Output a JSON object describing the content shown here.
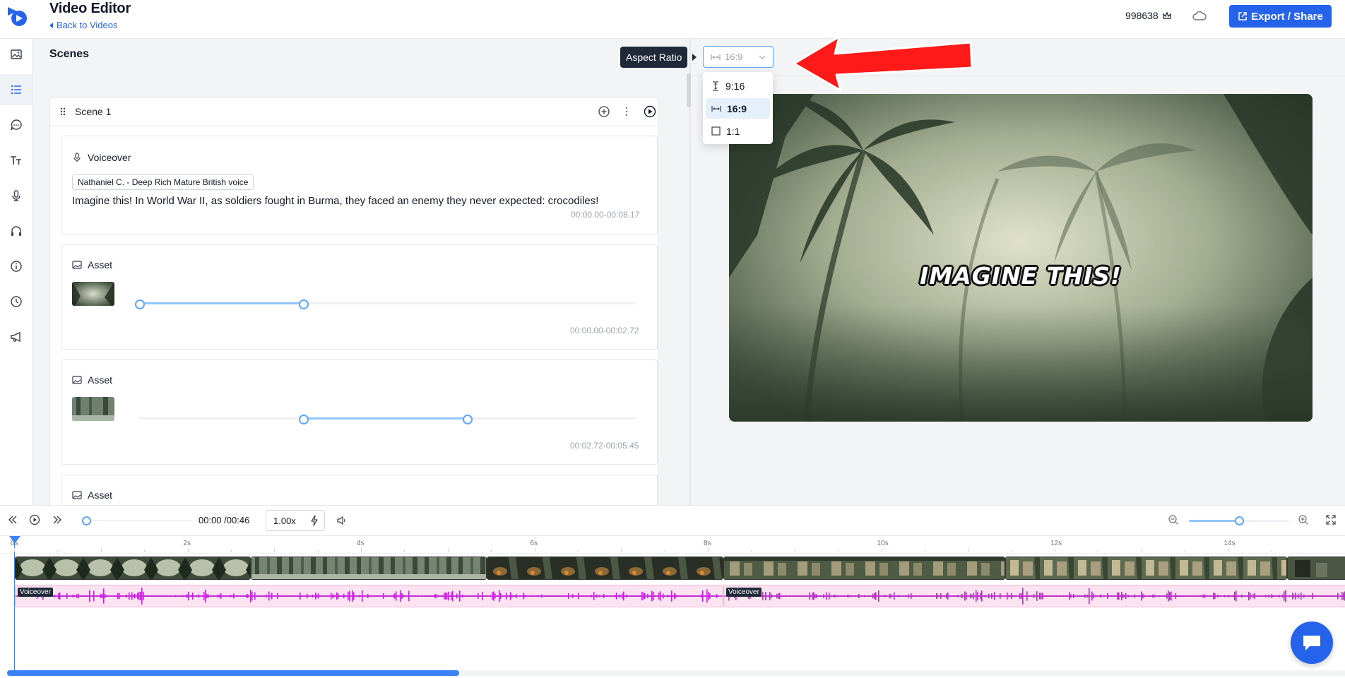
{
  "header": {
    "title": "Video Editor",
    "back_label": "Back to Videos",
    "credits": "998638",
    "export_label": "Export / Share"
  },
  "nav": {
    "items": [
      "image-icon",
      "list-icon",
      "chat-bubble-icon",
      "text-icon",
      "microphone-icon",
      "headphones-icon",
      "info-icon",
      "clock-icon",
      "megaphone-icon"
    ],
    "active": "list-icon"
  },
  "scenes": {
    "title": "Scenes",
    "scene": {
      "title": "Scene 1",
      "voiceover": {
        "label": "Voiceover",
        "voice": "Nathaniel C. - Deep Rich Mature British voice",
        "text": "Imagine this! In World War II, as soldiers fought in Burma, they faced an enemy they never expected: crocodiles!",
        "timecode": "00:00.00-00:08.17"
      },
      "assets": [
        {
          "label": "Asset",
          "timecode": "00:00.00-00:02.72",
          "range": [
            0.0,
            0.33
          ]
        },
        {
          "label": "Asset",
          "timecode": "00:02.72-00:05.45",
          "range": [
            0.33,
            0.66
          ]
        },
        {
          "label": "Asset"
        }
      ]
    }
  },
  "preview": {
    "caption": "IMAGINE THIS!",
    "aspect_ratio": {
      "tooltip": "Aspect Ratio",
      "current": "16:9",
      "options": [
        {
          "label": "9:16",
          "icon": "vertical-ratio-icon"
        },
        {
          "label": "16:9",
          "icon": "horizontal-ratio-icon",
          "selected": true
        },
        {
          "label": "1:1",
          "icon": "square-ratio-icon"
        }
      ]
    }
  },
  "timeline": {
    "current_time": "00:00",
    "total_time": "/00:46",
    "speed": "1.00x",
    "ticks": [
      "0s",
      "2s",
      "4s",
      "6s",
      "8s",
      "10s",
      "12s",
      "14s"
    ],
    "voiceover_label": "Voiceover"
  },
  "colors": {
    "accent": "#2563eb",
    "voiceover_track": "#fbe3f0",
    "waveform": "#c026d3",
    "annotation_arrow": "#ff1a1a"
  }
}
